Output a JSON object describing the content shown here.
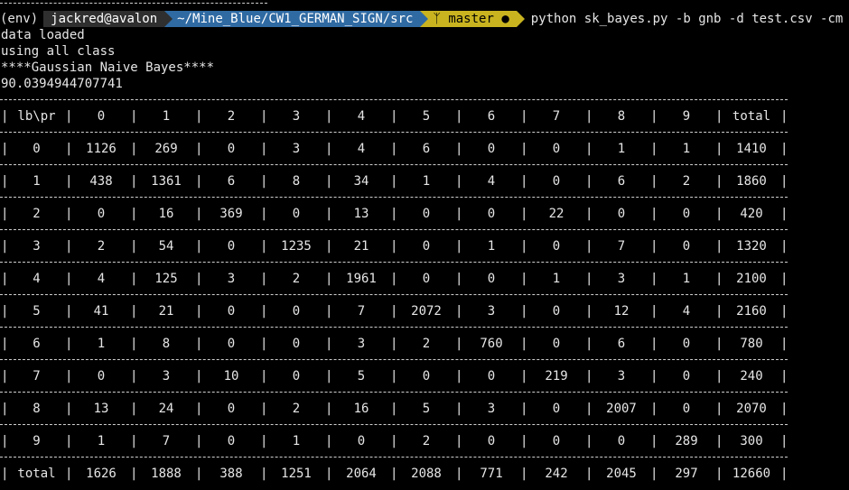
{
  "topline": "------------------------------",
  "prompt": {
    "env": "(env)",
    "user": "jackred@avalon",
    "path": "~/Mine_Blue/CW1_GERMAN_SIGN/src",
    "branch_icon": "git-branch-icon",
    "branch": "master",
    "dirty": "●",
    "command": "python sk_bayes.py -b gnb -d test.csv -cm"
  },
  "output": [
    "data loaded",
    "using all class",
    "****Gaussian Naive Bayes****",
    "90.0394944707741"
  ],
  "table": {
    "header": [
      "lb\\pr",
      "0",
      "1",
      "2",
      "3",
      "4",
      "5",
      "6",
      "7",
      "8",
      "9",
      "total"
    ],
    "rows": [
      [
        "0",
        "1126",
        "269",
        "0",
        "3",
        "4",
        "6",
        "0",
        "0",
        "1",
        "1",
        "1410"
      ],
      [
        "1",
        "438",
        "1361",
        "6",
        "8",
        "34",
        "1",
        "4",
        "0",
        "6",
        "2",
        "1860"
      ],
      [
        "2",
        "0",
        "16",
        "369",
        "0",
        "13",
        "0",
        "0",
        "22",
        "0",
        "0",
        "420"
      ],
      [
        "3",
        "2",
        "54",
        "0",
        "1235",
        "21",
        "0",
        "1",
        "0",
        "7",
        "0",
        "1320"
      ],
      [
        "4",
        "4",
        "125",
        "3",
        "2",
        "1961",
        "0",
        "0",
        "1",
        "3",
        "1",
        "2100"
      ],
      [
        "5",
        "41",
        "21",
        "0",
        "0",
        "7",
        "2072",
        "3",
        "0",
        "12",
        "4",
        "2160"
      ],
      [
        "6",
        "1",
        "8",
        "0",
        "0",
        "3",
        "2",
        "760",
        "0",
        "6",
        "0",
        "780"
      ],
      [
        "7",
        "0",
        "3",
        "10",
        "0",
        "5",
        "0",
        "0",
        "219",
        "3",
        "0",
        "240"
      ],
      [
        "8",
        "13",
        "24",
        "0",
        "2",
        "16",
        "5",
        "3",
        "0",
        "2007",
        "0",
        "2070"
      ],
      [
        "9",
        "1",
        "7",
        "0",
        "1",
        "0",
        "2",
        "0",
        "0",
        "0",
        "289",
        "300"
      ],
      [
        "total",
        "1626",
        "1888",
        "388",
        "1251",
        "2064",
        "2088",
        "771",
        "242",
        "2045",
        "297",
        "12660"
      ]
    ]
  }
}
